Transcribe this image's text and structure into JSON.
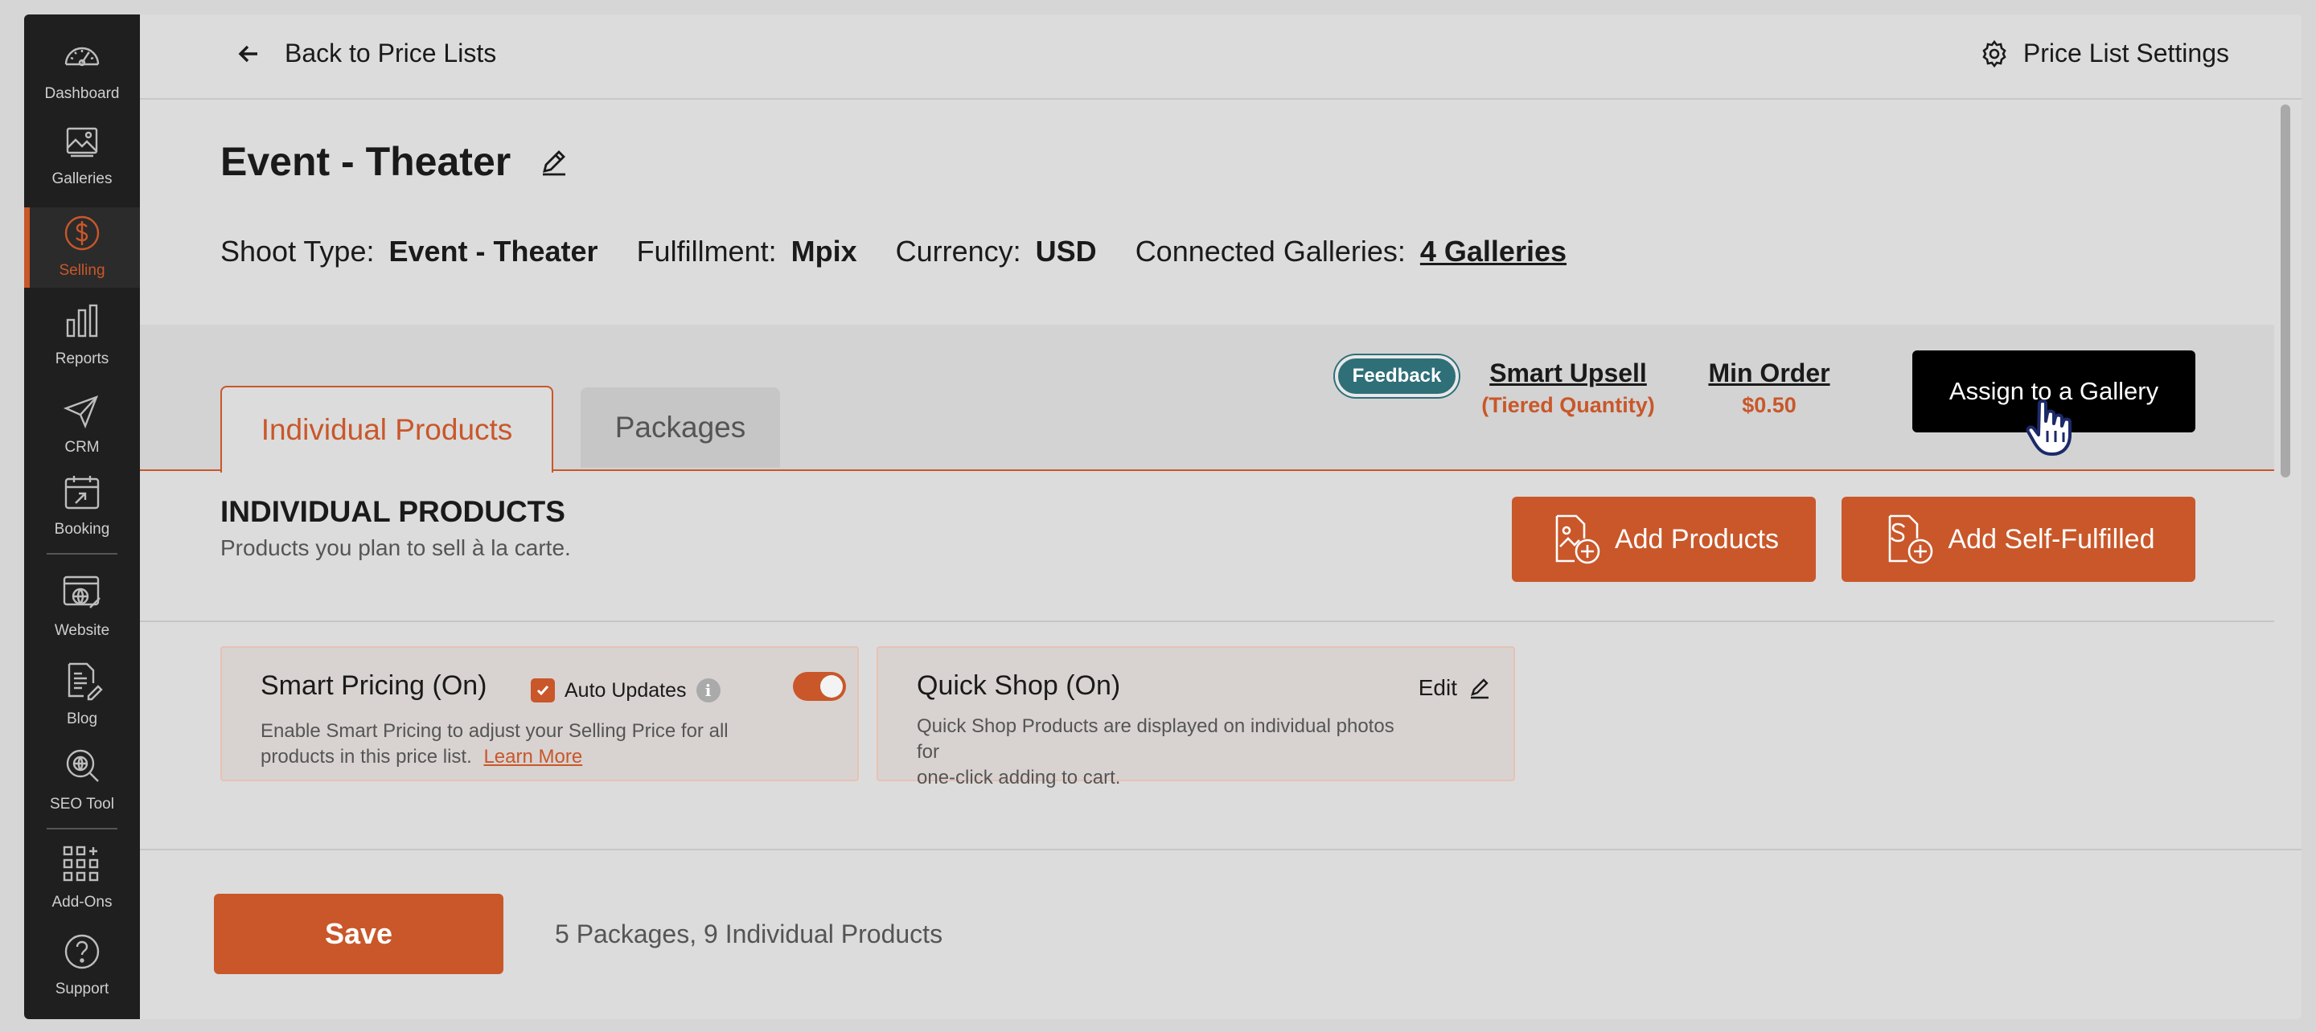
{
  "sidebar": {
    "items": [
      {
        "label": "Dashboard",
        "icon": "dashboard-icon"
      },
      {
        "label": "Galleries",
        "icon": "galleries-icon"
      },
      {
        "label": "Selling",
        "icon": "dollar-icon"
      },
      {
        "label": "Reports",
        "icon": "bar-chart-icon"
      },
      {
        "label": "CRM",
        "icon": "send-icon"
      },
      {
        "label": "Booking",
        "icon": "calendar-icon"
      },
      {
        "label": "Website",
        "icon": "website-icon"
      },
      {
        "label": "Blog",
        "icon": "blog-icon"
      },
      {
        "label": "SEO Tool",
        "icon": "seo-icon"
      },
      {
        "label": "Add-Ons",
        "icon": "grid-icon"
      },
      {
        "label": "Support",
        "icon": "help-icon"
      }
    ],
    "active": "Selling"
  },
  "header": {
    "back_label": "Back to Price Lists",
    "settings_label": "Price List Settings"
  },
  "price_list": {
    "title": "Event - Theater",
    "meta": {
      "shoot_type_label": "Shoot Type:",
      "shoot_type": "Event - Theater",
      "fulfillment_label": "Fulfillment:",
      "fulfillment": "Mpix",
      "currency_label": "Currency:",
      "currency": "USD",
      "galleries_label": "Connected Galleries:",
      "galleries": "4 Galleries"
    }
  },
  "tabs": [
    {
      "label": "Individual Products",
      "active": true
    },
    {
      "label": "Packages",
      "active": false
    }
  ],
  "toolbar": {
    "feedback": "Feedback",
    "smart_upsell": "Smart Upsell",
    "smart_upsell_sub": "(Tiered Quantity)",
    "min_order": "Min Order",
    "min_order_value": "$0.50",
    "assign": "Assign to a Gallery"
  },
  "section": {
    "title": "INDIVIDUAL PRODUCTS",
    "subtitle": "Products you plan to sell à la carte.",
    "add_products": "Add Products",
    "add_self_fulfilled": "Add Self-Fulfilled"
  },
  "smart_pricing": {
    "title": "Smart Pricing (On)",
    "auto_updates": "Auto Updates",
    "auto_updates_checked": true,
    "enabled": true,
    "desc_line1": "Enable Smart Pricing to adjust your Selling Price for all",
    "desc_line2": "products in this price list.",
    "learn_more": "Learn More"
  },
  "quick_shop": {
    "title": "Quick Shop (On)",
    "edit": "Edit",
    "desc_line1": "Quick Shop Products are displayed on individual photos for",
    "desc_line2": "one-click adding to cart."
  },
  "footer": {
    "save": "Save",
    "counts": "5 Packages, 9 Individual Products"
  },
  "colors": {
    "accent": "#c9572a",
    "sidebar_bg": "#1f1f1f",
    "feedback_bg": "#2f6f78"
  }
}
